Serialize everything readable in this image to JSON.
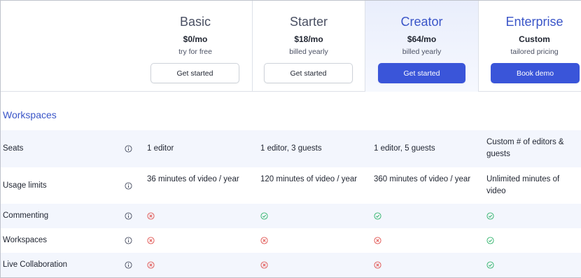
{
  "plans": [
    {
      "name": "Basic",
      "price": "$0/mo",
      "note": "try for free",
      "button": "Get started"
    },
    {
      "name": "Starter",
      "price": "$18/mo",
      "note": "billed yearly",
      "button": "Get started"
    },
    {
      "name": "Creator",
      "price": "$64/mo",
      "note": "billed yearly",
      "button": "Get started"
    },
    {
      "name": "Enterprise",
      "price": "Custom",
      "note": "tailored pricing",
      "button": "Book demo"
    }
  ],
  "section": {
    "title": "Workspaces"
  },
  "rows": [
    {
      "label": "Seats",
      "cells": [
        "1 editor",
        "1 editor, 3 guests",
        "1 editor, 5 guests",
        "Custom # of editors & guests"
      ]
    },
    {
      "label": "Usage limits",
      "cells": [
        "36 minutes of video / year",
        "120 minutes of video / year",
        "360 minutes of video / year",
        "Unlimited minutes of video"
      ]
    },
    {
      "label": "Commenting",
      "marks": [
        "no",
        "yes",
        "yes",
        "yes"
      ]
    },
    {
      "label": "Workspaces",
      "marks": [
        "no",
        "no",
        "no",
        "yes"
      ]
    },
    {
      "label": "Live Collaboration",
      "marks": [
        "no",
        "no",
        "no",
        "yes"
      ]
    }
  ],
  "icons": {
    "info": "info-icon",
    "yes": "check-circle-icon",
    "no": "x-circle-icon"
  },
  "colors": {
    "accent": "#3a55d9",
    "yes": "#2fb36b",
    "no": "#e0524f",
    "shaded_row": "#f3f6fd",
    "highlight": "#e9eefc"
  }
}
